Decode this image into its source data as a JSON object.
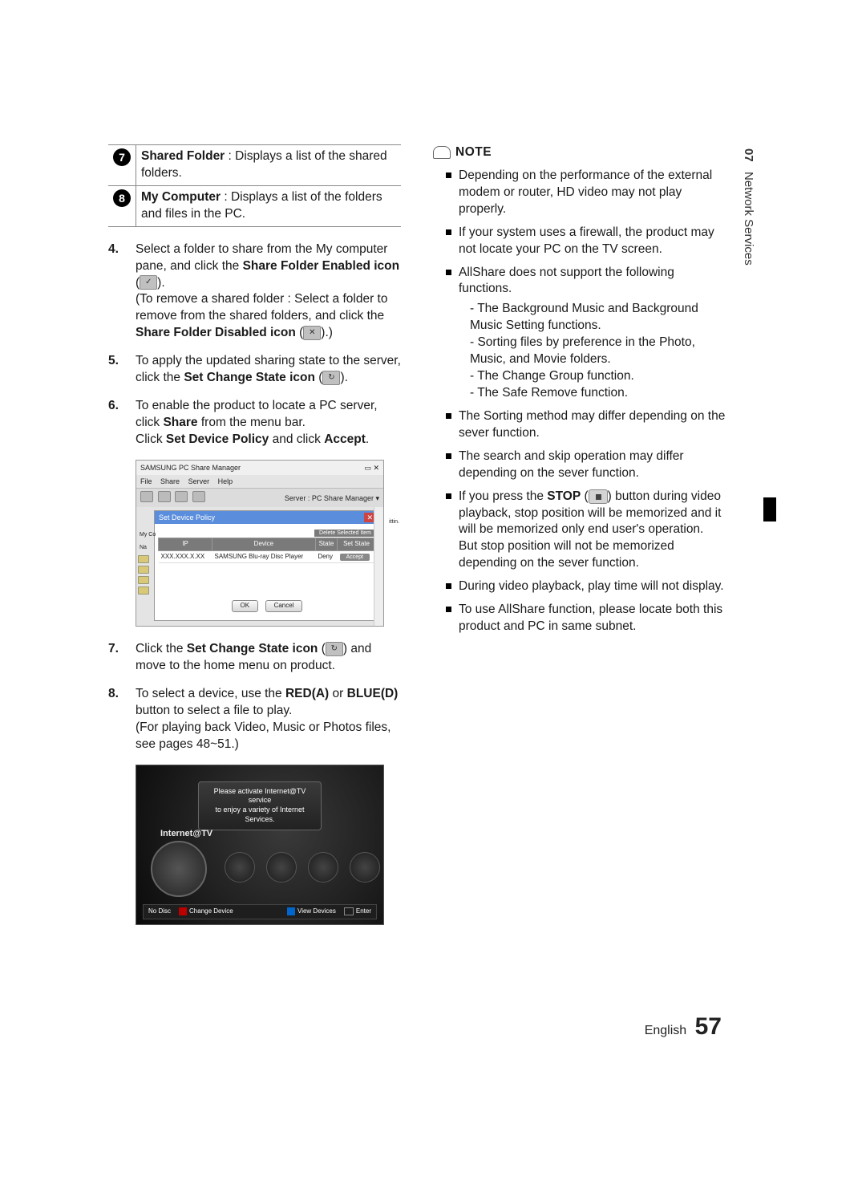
{
  "side_tab": {
    "chapter": "07",
    "title": "Network Services"
  },
  "legend": {
    "rows": [
      {
        "num": "7",
        "label": "Shared Folder",
        "desc": " : Displays a list of the shared folders."
      },
      {
        "num": "8",
        "label": "My Computer",
        "desc": " : Displays a list of the folders and files in the PC."
      }
    ]
  },
  "steps": {
    "s4_a": "Select a folder to share from the My computer pane, and click the ",
    "s4_bold1": "Share Folder Enabled icon",
    "s4_b": " (",
    "s4_c": ").",
    "s4_d": "(To remove a shared folder : Select a folder to remove from the shared folders, and click the ",
    "s4_bold2": "Share Folder Disabled icon",
    "s4_e": " (",
    "s4_f": ").)",
    "s5_a": "To apply the updated sharing state to the server, click the ",
    "s5_bold": "Set Change State icon",
    "s5_b": " (",
    "s5_c": ").",
    "s6_a": "To enable the product to locate a PC server, click ",
    "s6_bold1": "Share",
    "s6_b": " from the menu bar.",
    "s6_c": "Click ",
    "s6_bold2": "Set Device Policy",
    "s6_d": " and click ",
    "s6_bold3": "Accept",
    "s6_e": ".",
    "s7_a": "Click the ",
    "s7_bold": "Set Change State icon",
    "s7_b": " (",
    "s7_c": ") and move to the home menu on product.",
    "s8_a": "To select a device, use the ",
    "s8_red": "RED(A)",
    "s8_b": " or ",
    "s8_blue": "BLUE(D)",
    "s8_c": " button to select a file to play.",
    "s8_d": "(For playing back Video, Music or Photos files, see pages 48~51.)"
  },
  "dialog": {
    "app_title": "SAMSUNG PC Share Manager",
    "menu": {
      "file": "File",
      "share": "Share",
      "server": "Server",
      "help": "Help"
    },
    "server_label": "Server : PC Share Manager ▾",
    "sub_title": "Set Device Policy",
    "delete_btn": "Delete Selected Item",
    "cols": {
      "ip": "IP",
      "device": "Device",
      "state": "State",
      "set": "Set State"
    },
    "row": {
      "ip": "XXX.XXX.X.XX",
      "device": "SAMSUNG Blu-ray Disc Player",
      "state": "Deny",
      "set": "Accept"
    },
    "ok": "OK",
    "cancel": "Cancel",
    "myco": "My Co",
    "na": "Na",
    "ittin": "ittin."
  },
  "tv": {
    "banner1": "Please activate Internet@TV service",
    "banner2": "to enjoy a variety of Internet Services.",
    "label": "Internet@TV",
    "no_disc": "No Disc",
    "change": "Change Device",
    "view": "View Devices",
    "enter": "Enter"
  },
  "note": {
    "title": "NOTE",
    "items": [
      "Depending on the performance of the external modem or router, HD video may not play properly.",
      "If your system uses a firewall, the product may not locate your PC on the TV screen.",
      "AllShare does not support the following functions.",
      "The Sorting method may differ depending on the sever function.",
      "The search and skip operation may differ depending on the sever function."
    ],
    "sub3": [
      "The Background Music and Background Music Setting functions.",
      "Sorting files by preference in the Photo, Music, and Movie folders.",
      "The Change Group function.",
      "The Safe Remove function."
    ],
    "stop_a": "If you press the ",
    "stop_bold": "STOP",
    "stop_b": " (",
    "stop_c": ") button during video playback, stop position will be memorized and it will be memorized only end user's operation.",
    "stop_d": "But stop position will not be memorized depending on the sever function.",
    "last": [
      "During video playback, play time will not display.",
      "To use AllShare function, please locate both this product and PC in same subnet."
    ]
  },
  "footer": {
    "lang": "English",
    "page": "57"
  }
}
